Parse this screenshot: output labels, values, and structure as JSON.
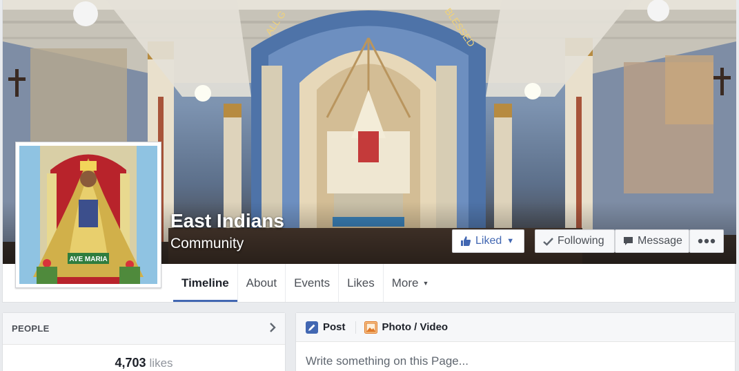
{
  "page": {
    "name": "East Indians",
    "category": "Community"
  },
  "profile_picture": {
    "caption": "AVE MARIA"
  },
  "cover_photo": {
    "arch_text_left": "ALL G",
    "arch_text_right": "BLESSED"
  },
  "actions": {
    "liked_label": "Liked",
    "following_label": "Following",
    "message_label": "Message"
  },
  "tabs": [
    {
      "label": "Timeline",
      "active": true
    },
    {
      "label": "About"
    },
    {
      "label": "Events"
    },
    {
      "label": "Likes"
    },
    {
      "label": "More"
    }
  ],
  "people": {
    "title": "PEOPLE",
    "likes_count": "4,703",
    "likes_label": "likes"
  },
  "composer": {
    "post_label": "Post",
    "photo_label": "Photo / Video",
    "placeholder": "Write something on this Page..."
  },
  "colors": {
    "brand": "#4267b2",
    "background": "#e9ebee"
  },
  "icons": {
    "liked": "thumbs-up-icon",
    "following": "checkmark-icon",
    "message": "message-icon",
    "more": "ellipsis-icon",
    "people": "chevron-right-icon",
    "post": "pencil-icon",
    "photo": "photo-icon"
  }
}
